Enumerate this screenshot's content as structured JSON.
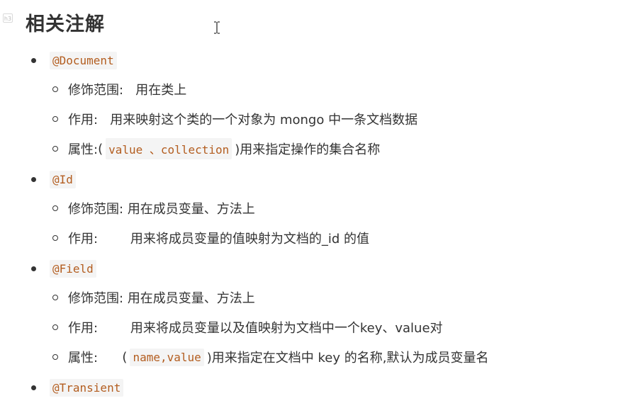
{
  "heading": {
    "marker_label": "h3",
    "title": "相关注解"
  },
  "sections": [
    {
      "annotation": "@Document",
      "items": [
        {
          "label": "修饰范围:",
          "sep": "   ",
          "text": "用在类上"
        },
        {
          "label": "作用:",
          "sep": "   ",
          "text": "用来映射这个类的一个对象为 mongo 中一条文档数据"
        },
        {
          "label": "属性:",
          "open": "(",
          "code": "value 、collection",
          "text": ")用来指定操作的集合名称"
        }
      ]
    },
    {
      "annotation": "@Id",
      "items": [
        {
          "label": "修饰范围:",
          "sep": " ",
          "text": "用在成员变量、方法上"
        },
        {
          "label": "作用:",
          "sep": "        ",
          "text": "用来将成员变量的值映射为文档的_id 的值"
        }
      ]
    },
    {
      "annotation": "@Field",
      "items": [
        {
          "label": "修饰范围:",
          "sep": " ",
          "text": "用在成员变量、方法上"
        },
        {
          "label": "作用:",
          "sep": "        ",
          "text": "用来将成员变量以及值映射为文档中一个key、value对"
        },
        {
          "label": "属性:",
          "open": "      (",
          "code": "name,value",
          "text": ")用来指定在文档中 key 的名称,默认为成员变量名"
        }
      ]
    },
    {
      "annotation": "@Transient",
      "items": []
    }
  ]
}
